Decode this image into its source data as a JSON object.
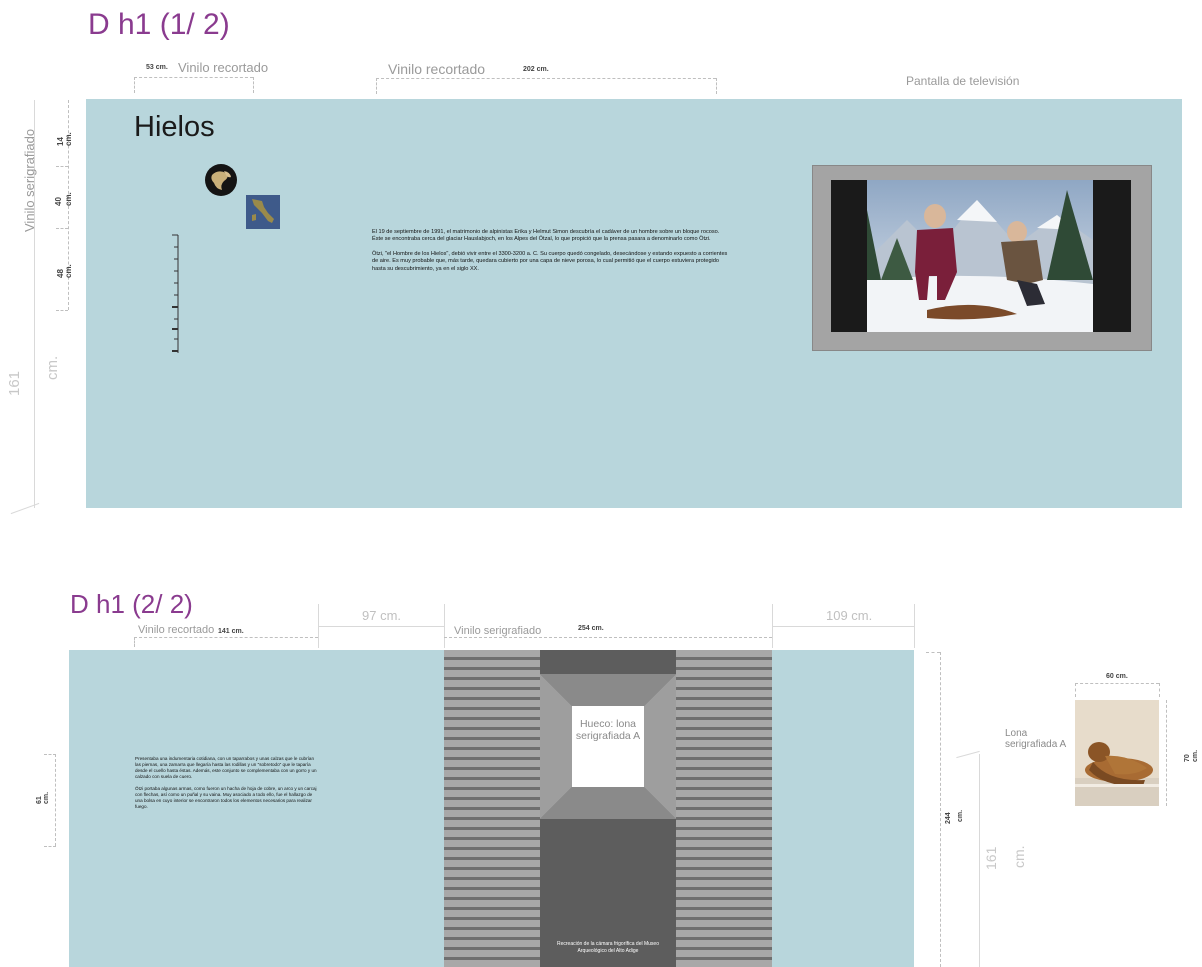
{
  "section1": {
    "title": "D h1 (1/ 2)",
    "dim_53": "53 cm.",
    "label_vinilo_recortado_a": "Vinilo recortado",
    "label_vinilo_recortado_b": "Vinilo recortado",
    "dim_202": "202 cm.",
    "label_pantalla": "Pantalla de televisión",
    "heading": "Hielos",
    "dim_14": "14",
    "dim_40": "40",
    "dim_48": "48",
    "cm_a": "cm.",
    "cm_b": "cm.",
    "cm_c": "cm.",
    "label_vinilo_serigrafiado": "Vinilo serigrafiado",
    "dim_161": "161",
    "cm_161": "cm.",
    "paragraph_1": "El 19 de septiembre de 1991, el matrimonio de alpinistas Erika y Helmut Simon descubría el cadáver de un hombre sobre un bloque rocoso. Éste se encontraba cerca del glaciar Hauslabjoch, en los Alpes del Ötzal, lo que propició que la prensa pasara a denominarlo como Ötzi.",
    "paragraph_2": "Ötzi, \"el Hombre de los Hielos\", debió vivir entre el 3300-3200 a. C. Su cuerpo quedó congelado, desecándose y estando expuesto a corrientes de aire. Es muy probable que, más tarde, quedara cubierto por una capa de nieve porosa, lo cual permitió que el cuerpo estuviera protegido hasta su descubrimiento, ya en el siglo XX."
  },
  "section2": {
    "title": "D h1 (2/ 2)",
    "label_vinilo_recortado": "Vinilo recortado",
    "dim_141": "141 cm.",
    "dim_97": "97 cm.",
    "label_vinilo_serigrafiado": "Vinilo serigrafiado",
    "dim_254": "254 cm.",
    "dim_109": "109 cm.",
    "dim_61": "61",
    "cm_61": "cm.",
    "paragraph_1": "Presentaba una indumentaria cotidiana, con un taparrabos y unas calzas que le cubrían las piernas, una zamarra que llegaría hasta las rodillas y un \"sobretodo\" que le taparía desde el cuello hasta éstas. Además, este conjunto se complementaba con un gorro y un calzado con suela de cuero.",
    "paragraph_2": "Ötzi portaba algunas armas, como fueron un hacha de hoja de cobre, un arco y un carcaj con flechas, así como un puñal y su vaina. Muy asociado a todo ello, fue el hallazgo de una bolsa en cuyo interior se encontraron todos los elementos necesarios para realizar fuego.",
    "hueco_label": "Hueco: lona serigrafiada A",
    "caption": "Recreación de la cámara frigorífica del Museo Arqueológico del Alto Adige",
    "dim_244": "244",
    "cm_244": "cm.",
    "dim_161": "161",
    "cm_161": "cm.",
    "lona_label": "Lona serigrafiada A",
    "dim_60": "60 cm.",
    "dim_70": "70",
    "cm_70": "cm."
  }
}
